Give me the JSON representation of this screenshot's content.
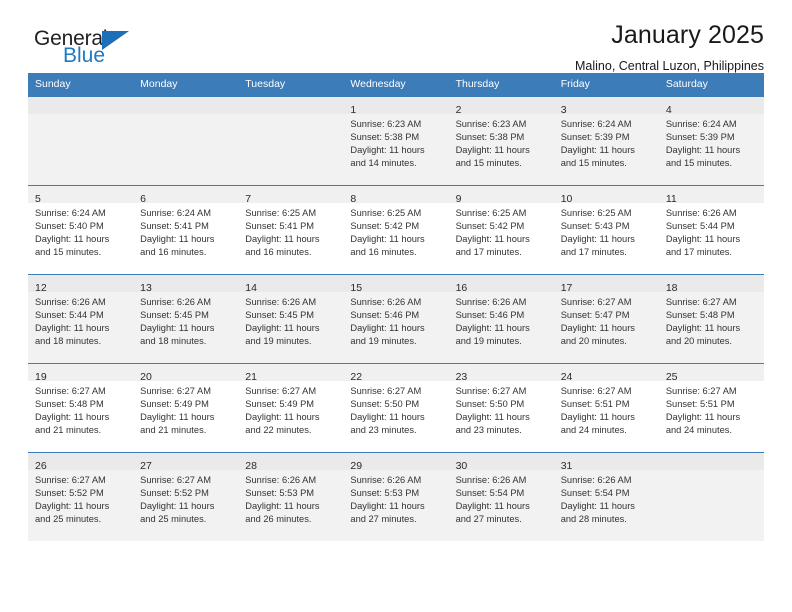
{
  "brand": {
    "name_part1": "General",
    "name_part2": "Blue",
    "flag_icon": "triangle-flag-icon",
    "accent_color": "#1d70b8"
  },
  "header": {
    "title": "January 2025",
    "subtitle": "Malino, Central Luzon, Philippines"
  },
  "calendar": {
    "header_bg": "#3c7cb8",
    "weekdays": [
      "Sunday",
      "Monday",
      "Tuesday",
      "Wednesday",
      "Thursday",
      "Friday",
      "Saturday"
    ],
    "weeks": [
      [
        {
          "day": "",
          "lines": []
        },
        {
          "day": "",
          "lines": []
        },
        {
          "day": "",
          "lines": []
        },
        {
          "day": "1",
          "lines": [
            "Sunrise: 6:23 AM",
            "Sunset: 5:38 PM",
            "Daylight: 11 hours",
            "and 14 minutes."
          ]
        },
        {
          "day": "2",
          "lines": [
            "Sunrise: 6:23 AM",
            "Sunset: 5:38 PM",
            "Daylight: 11 hours",
            "and 15 minutes."
          ]
        },
        {
          "day": "3",
          "lines": [
            "Sunrise: 6:24 AM",
            "Sunset: 5:39 PM",
            "Daylight: 11 hours",
            "and 15 minutes."
          ]
        },
        {
          "day": "4",
          "lines": [
            "Sunrise: 6:24 AM",
            "Sunset: 5:39 PM",
            "Daylight: 11 hours",
            "and 15 minutes."
          ]
        }
      ],
      [
        {
          "day": "5",
          "lines": [
            "Sunrise: 6:24 AM",
            "Sunset: 5:40 PM",
            "Daylight: 11 hours",
            "and 15 minutes."
          ]
        },
        {
          "day": "6",
          "lines": [
            "Sunrise: 6:24 AM",
            "Sunset: 5:41 PM",
            "Daylight: 11 hours",
            "and 16 minutes."
          ]
        },
        {
          "day": "7",
          "lines": [
            "Sunrise: 6:25 AM",
            "Sunset: 5:41 PM",
            "Daylight: 11 hours",
            "and 16 minutes."
          ]
        },
        {
          "day": "8",
          "lines": [
            "Sunrise: 6:25 AM",
            "Sunset: 5:42 PM",
            "Daylight: 11 hours",
            "and 16 minutes."
          ]
        },
        {
          "day": "9",
          "lines": [
            "Sunrise: 6:25 AM",
            "Sunset: 5:42 PM",
            "Daylight: 11 hours",
            "and 17 minutes."
          ]
        },
        {
          "day": "10",
          "lines": [
            "Sunrise: 6:25 AM",
            "Sunset: 5:43 PM",
            "Daylight: 11 hours",
            "and 17 minutes."
          ]
        },
        {
          "day": "11",
          "lines": [
            "Sunrise: 6:26 AM",
            "Sunset: 5:44 PM",
            "Daylight: 11 hours",
            "and 17 minutes."
          ]
        }
      ],
      [
        {
          "day": "12",
          "lines": [
            "Sunrise: 6:26 AM",
            "Sunset: 5:44 PM",
            "Daylight: 11 hours",
            "and 18 minutes."
          ]
        },
        {
          "day": "13",
          "lines": [
            "Sunrise: 6:26 AM",
            "Sunset: 5:45 PM",
            "Daylight: 11 hours",
            "and 18 minutes."
          ]
        },
        {
          "day": "14",
          "lines": [
            "Sunrise: 6:26 AM",
            "Sunset: 5:45 PM",
            "Daylight: 11 hours",
            "and 19 minutes."
          ]
        },
        {
          "day": "15",
          "lines": [
            "Sunrise: 6:26 AM",
            "Sunset: 5:46 PM",
            "Daylight: 11 hours",
            "and 19 minutes."
          ]
        },
        {
          "day": "16",
          "lines": [
            "Sunrise: 6:26 AM",
            "Sunset: 5:46 PM",
            "Daylight: 11 hours",
            "and 19 minutes."
          ]
        },
        {
          "day": "17",
          "lines": [
            "Sunrise: 6:27 AM",
            "Sunset: 5:47 PM",
            "Daylight: 11 hours",
            "and 20 minutes."
          ]
        },
        {
          "day": "18",
          "lines": [
            "Sunrise: 6:27 AM",
            "Sunset: 5:48 PM",
            "Daylight: 11 hours",
            "and 20 minutes."
          ]
        }
      ],
      [
        {
          "day": "19",
          "lines": [
            "Sunrise: 6:27 AM",
            "Sunset: 5:48 PM",
            "Daylight: 11 hours",
            "and 21 minutes."
          ]
        },
        {
          "day": "20",
          "lines": [
            "Sunrise: 6:27 AM",
            "Sunset: 5:49 PM",
            "Daylight: 11 hours",
            "and 21 minutes."
          ]
        },
        {
          "day": "21",
          "lines": [
            "Sunrise: 6:27 AM",
            "Sunset: 5:49 PM",
            "Daylight: 11 hours",
            "and 22 minutes."
          ]
        },
        {
          "day": "22",
          "lines": [
            "Sunrise: 6:27 AM",
            "Sunset: 5:50 PM",
            "Daylight: 11 hours",
            "and 23 minutes."
          ]
        },
        {
          "day": "23",
          "lines": [
            "Sunrise: 6:27 AM",
            "Sunset: 5:50 PM",
            "Daylight: 11 hours",
            "and 23 minutes."
          ]
        },
        {
          "day": "24",
          "lines": [
            "Sunrise: 6:27 AM",
            "Sunset: 5:51 PM",
            "Daylight: 11 hours",
            "and 24 minutes."
          ]
        },
        {
          "day": "25",
          "lines": [
            "Sunrise: 6:27 AM",
            "Sunset: 5:51 PM",
            "Daylight: 11 hours",
            "and 24 minutes."
          ]
        }
      ],
      [
        {
          "day": "26",
          "lines": [
            "Sunrise: 6:27 AM",
            "Sunset: 5:52 PM",
            "Daylight: 11 hours",
            "and 25 minutes."
          ]
        },
        {
          "day": "27",
          "lines": [
            "Sunrise: 6:27 AM",
            "Sunset: 5:52 PM",
            "Daylight: 11 hours",
            "and 25 minutes."
          ]
        },
        {
          "day": "28",
          "lines": [
            "Sunrise: 6:26 AM",
            "Sunset: 5:53 PM",
            "Daylight: 11 hours",
            "and 26 minutes."
          ]
        },
        {
          "day": "29",
          "lines": [
            "Sunrise: 6:26 AM",
            "Sunset: 5:53 PM",
            "Daylight: 11 hours",
            "and 27 minutes."
          ]
        },
        {
          "day": "30",
          "lines": [
            "Sunrise: 6:26 AM",
            "Sunset: 5:54 PM",
            "Daylight: 11 hours",
            "and 27 minutes."
          ]
        },
        {
          "day": "31",
          "lines": [
            "Sunrise: 6:26 AM",
            "Sunset: 5:54 PM",
            "Daylight: 11 hours",
            "and 28 minutes."
          ]
        },
        {
          "day": "",
          "lines": []
        }
      ]
    ]
  }
}
